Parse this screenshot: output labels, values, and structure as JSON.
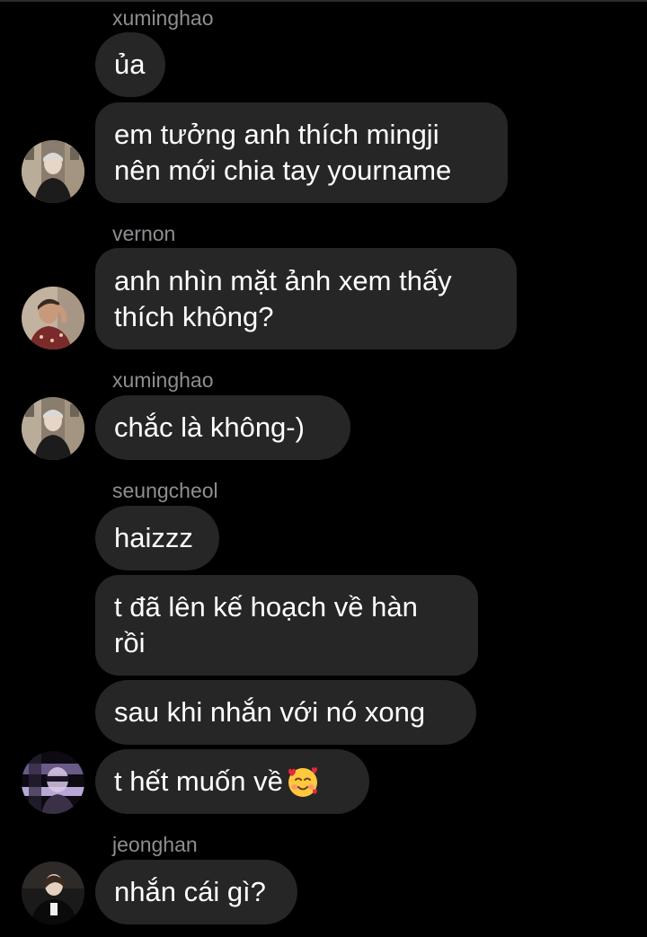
{
  "chat": {
    "senders": {
      "s1": "xuminghao",
      "s2": "vernon",
      "s3": "xuminghao",
      "s4": "seungcheol",
      "s5": "jeonghan"
    },
    "messages": {
      "m1": "ủa",
      "m2": "em tưởng anh thích mingji\nnên mới chia tay yourname",
      "m3": "anh nhìn mặt ảnh xem thấy\nthích không?",
      "m4": "chắc là không-)",
      "m5": "haizzz",
      "m6": "t đã lên kế hoạch về hàn\nrồi",
      "m7": "sau khi nhắn với nó xong",
      "m8": "t hết muốn về",
      "m9": "nhắn cái gì?"
    },
    "icons": {
      "m8_emoji": "smiling-face-with-hearts-emoji"
    },
    "colors": {
      "background": "#000000",
      "bubble": "#262626",
      "sender_text": "#8e8e93",
      "message_text": "#ffffff"
    }
  }
}
